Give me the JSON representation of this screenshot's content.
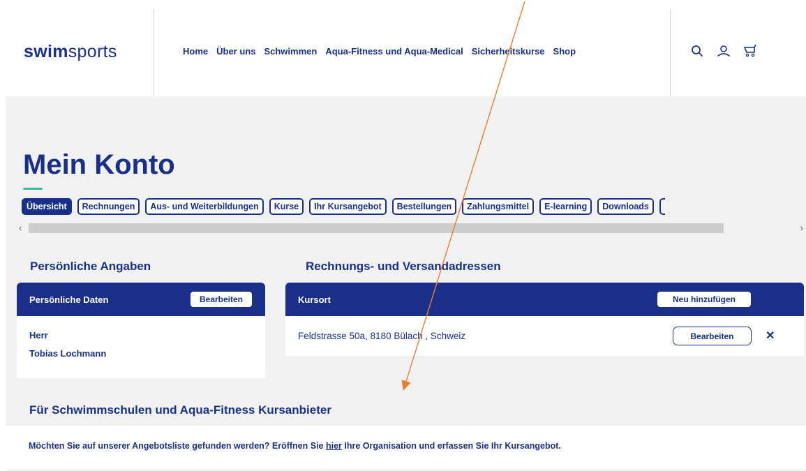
{
  "header": {
    "logo_part1": "swim",
    "logo_part2": "sports",
    "nav": [
      "Home",
      "Über uns",
      "Schwimmen",
      "Aqua-Fitness und Aqua-Medical",
      "Sicherheitskurse",
      "Shop"
    ],
    "icons": [
      "search-icon",
      "user-icon",
      "cart-icon"
    ]
  },
  "page": {
    "title": "Mein Konto",
    "tabs": [
      "Übersicht",
      "Rechnungen",
      "Aus- und Weiterbildungen",
      "Kurse",
      "Ihr Kursangebot",
      "Bestellungen",
      "Zahlungsmittel",
      "E-learning",
      "Downloads"
    ],
    "active_tab": "Übersicht",
    "scroll_left": "‹",
    "scroll_right": "›"
  },
  "personal": {
    "section_title": "Persönliche Angaben",
    "card_title": "Persönliche Daten",
    "edit_label": "Bearbeiten",
    "salutation": "Herr",
    "name": "Tobias Lochmann"
  },
  "addresses": {
    "section_title": "Rechnungs- und Versandadressen",
    "card_title": "Kursort",
    "add_label": "Neu hinzufügen",
    "address": "Feldstrasse 50a, 8180 Bülach , Schweiz",
    "edit_label": "Bearbeiten",
    "delete_symbol": "✕"
  },
  "providers": {
    "section_title": "Für Schwimmschulen und Aqua-Fitness Kursanbieter",
    "text_before": "Möchten Sie auf unserer Angebotsliste gefunden werden? Eröffnen Sie ",
    "link": "hier",
    "text_after": " Ihre Organisation und erfassen Sie Ihr Kursangebot."
  },
  "colors": {
    "brand_blue": "#1a2f8a",
    "accent_green": "#3fb99a",
    "annotation_orange": "#f07b2a",
    "background": "#f1f1f1"
  }
}
